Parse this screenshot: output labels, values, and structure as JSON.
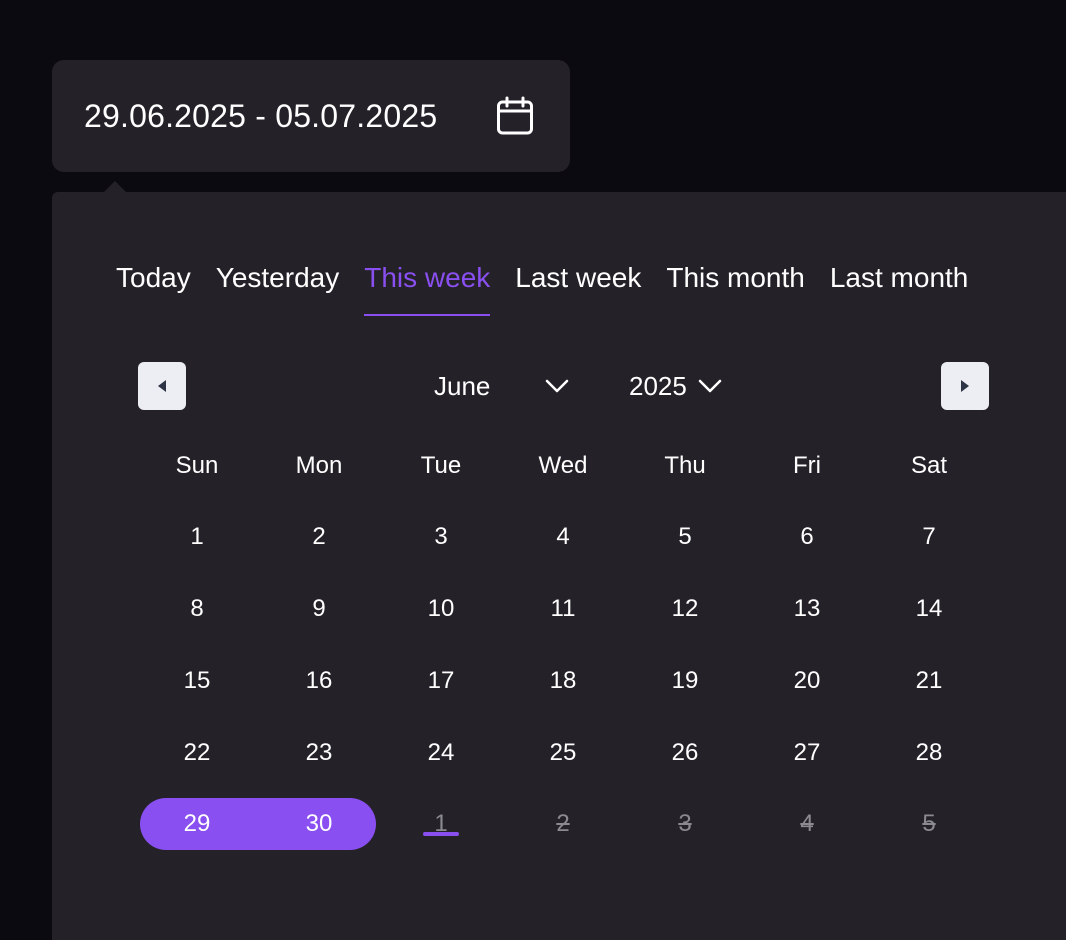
{
  "date_input": {
    "value": "29.06.2025 - 05.07.2025",
    "icon": "calendar-icon"
  },
  "tabs": [
    {
      "label": "Today",
      "active": false
    },
    {
      "label": "Yesterday",
      "active": false
    },
    {
      "label": "This week",
      "active": true
    },
    {
      "label": "Last week",
      "active": false
    },
    {
      "label": "This month",
      "active": false
    },
    {
      "label": "Last month",
      "active": false
    }
  ],
  "nav": {
    "prev_icon": "triangle-left-icon",
    "next_icon": "triangle-right-icon",
    "month": "June",
    "year": "2025"
  },
  "weekdays": [
    "Sun",
    "Mon",
    "Tue",
    "Wed",
    "Thu",
    "Fri",
    "Sat"
  ],
  "weeks": [
    [
      "1",
      "2",
      "3",
      "4",
      "5",
      "6",
      "7"
    ],
    [
      "8",
      "9",
      "10",
      "11",
      "12",
      "13",
      "14"
    ],
    [
      "15",
      "16",
      "17",
      "18",
      "19",
      "20",
      "21"
    ],
    [
      "22",
      "23",
      "24",
      "25",
      "26",
      "27",
      "28"
    ],
    [
      "29",
      "30",
      "1",
      "2",
      "3",
      "4",
      "5"
    ]
  ],
  "selected_range": {
    "start": "29",
    "end": "30"
  },
  "today": "1",
  "disabled_days": [
    "2",
    "3",
    "4",
    "5"
  ],
  "colors": {
    "accent": "#8a4ff0",
    "background": "#0b0a10",
    "panel": "#242228",
    "muted_text": "#8b8a90"
  }
}
